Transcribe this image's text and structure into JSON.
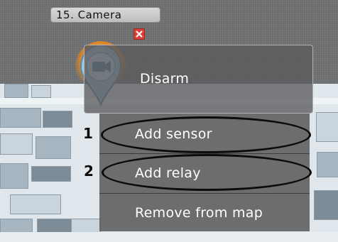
{
  "camera": {
    "label": "15. Camera",
    "icon": "camera-icon",
    "pin_color": "#f5a23a"
  },
  "close_button": {
    "icon": "close-icon",
    "color": "#d9403a"
  },
  "context_menu": {
    "items": [
      {
        "label": "Disarm"
      },
      {
        "label": "Add sensor"
      },
      {
        "label": "Add relay"
      },
      {
        "label": "Remove from map"
      }
    ]
  },
  "annotations": {
    "markers": [
      "1",
      "2"
    ]
  }
}
